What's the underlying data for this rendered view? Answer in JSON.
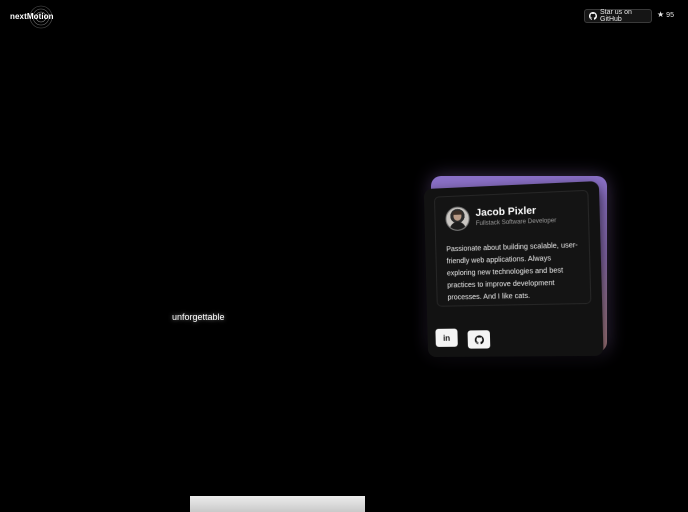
{
  "header": {
    "logo_text": "nextMotion",
    "github_button_label": "Star us on GitHub",
    "github_icon": "github-icon",
    "star_icon": "star-icon",
    "star_count": "95"
  },
  "hero": {
    "word": "unforgettable"
  },
  "profile_card": {
    "name": "Jacob Pixler",
    "role": "Fullstack Software Developer",
    "bio": "Passionate about building scalable, user-friendly web applications. Always exploring new technologies and best practices to improve development processes. And I like cats.",
    "linkedin_label": "in",
    "linkedin_icon": "linkedin-icon",
    "github_icon": "github-icon",
    "accent_gradient": [
      "#8a70c8",
      "#b8868a"
    ]
  }
}
